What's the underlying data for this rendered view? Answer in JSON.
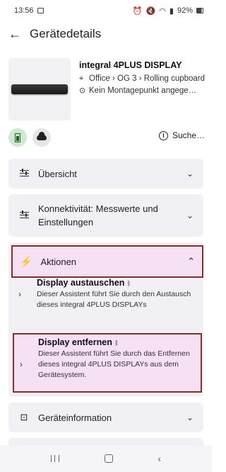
{
  "status": {
    "time": "13:56",
    "battery": "92%"
  },
  "header": {
    "title": "Gerätedetails"
  },
  "device": {
    "name": "integral 4PLUS DISPLAY",
    "location": "Office › OG 3 › Rolling cupboard",
    "mount": "Kein Montagepunkt angege…"
  },
  "chips": {
    "search_label": "Suche…"
  },
  "sections": {
    "overview": "Übersicht",
    "connectivity": "Konnektivität: Messwerte und Einstellungen",
    "actions": "Aktionen",
    "device_info": "Geräteinformation"
  },
  "actions": [
    {
      "title": "Display austauschen",
      "desc": "Dieser Assistent führt Sie durch den Austausch dieses integral 4PLUS DISPLAYs"
    },
    {
      "title": "Display entfernen",
      "desc": "Dieser Assistent führt Sie durch das Entfernen dieses integral 4PLUS DISPLAYs aus dem Gerätesystem."
    }
  ]
}
